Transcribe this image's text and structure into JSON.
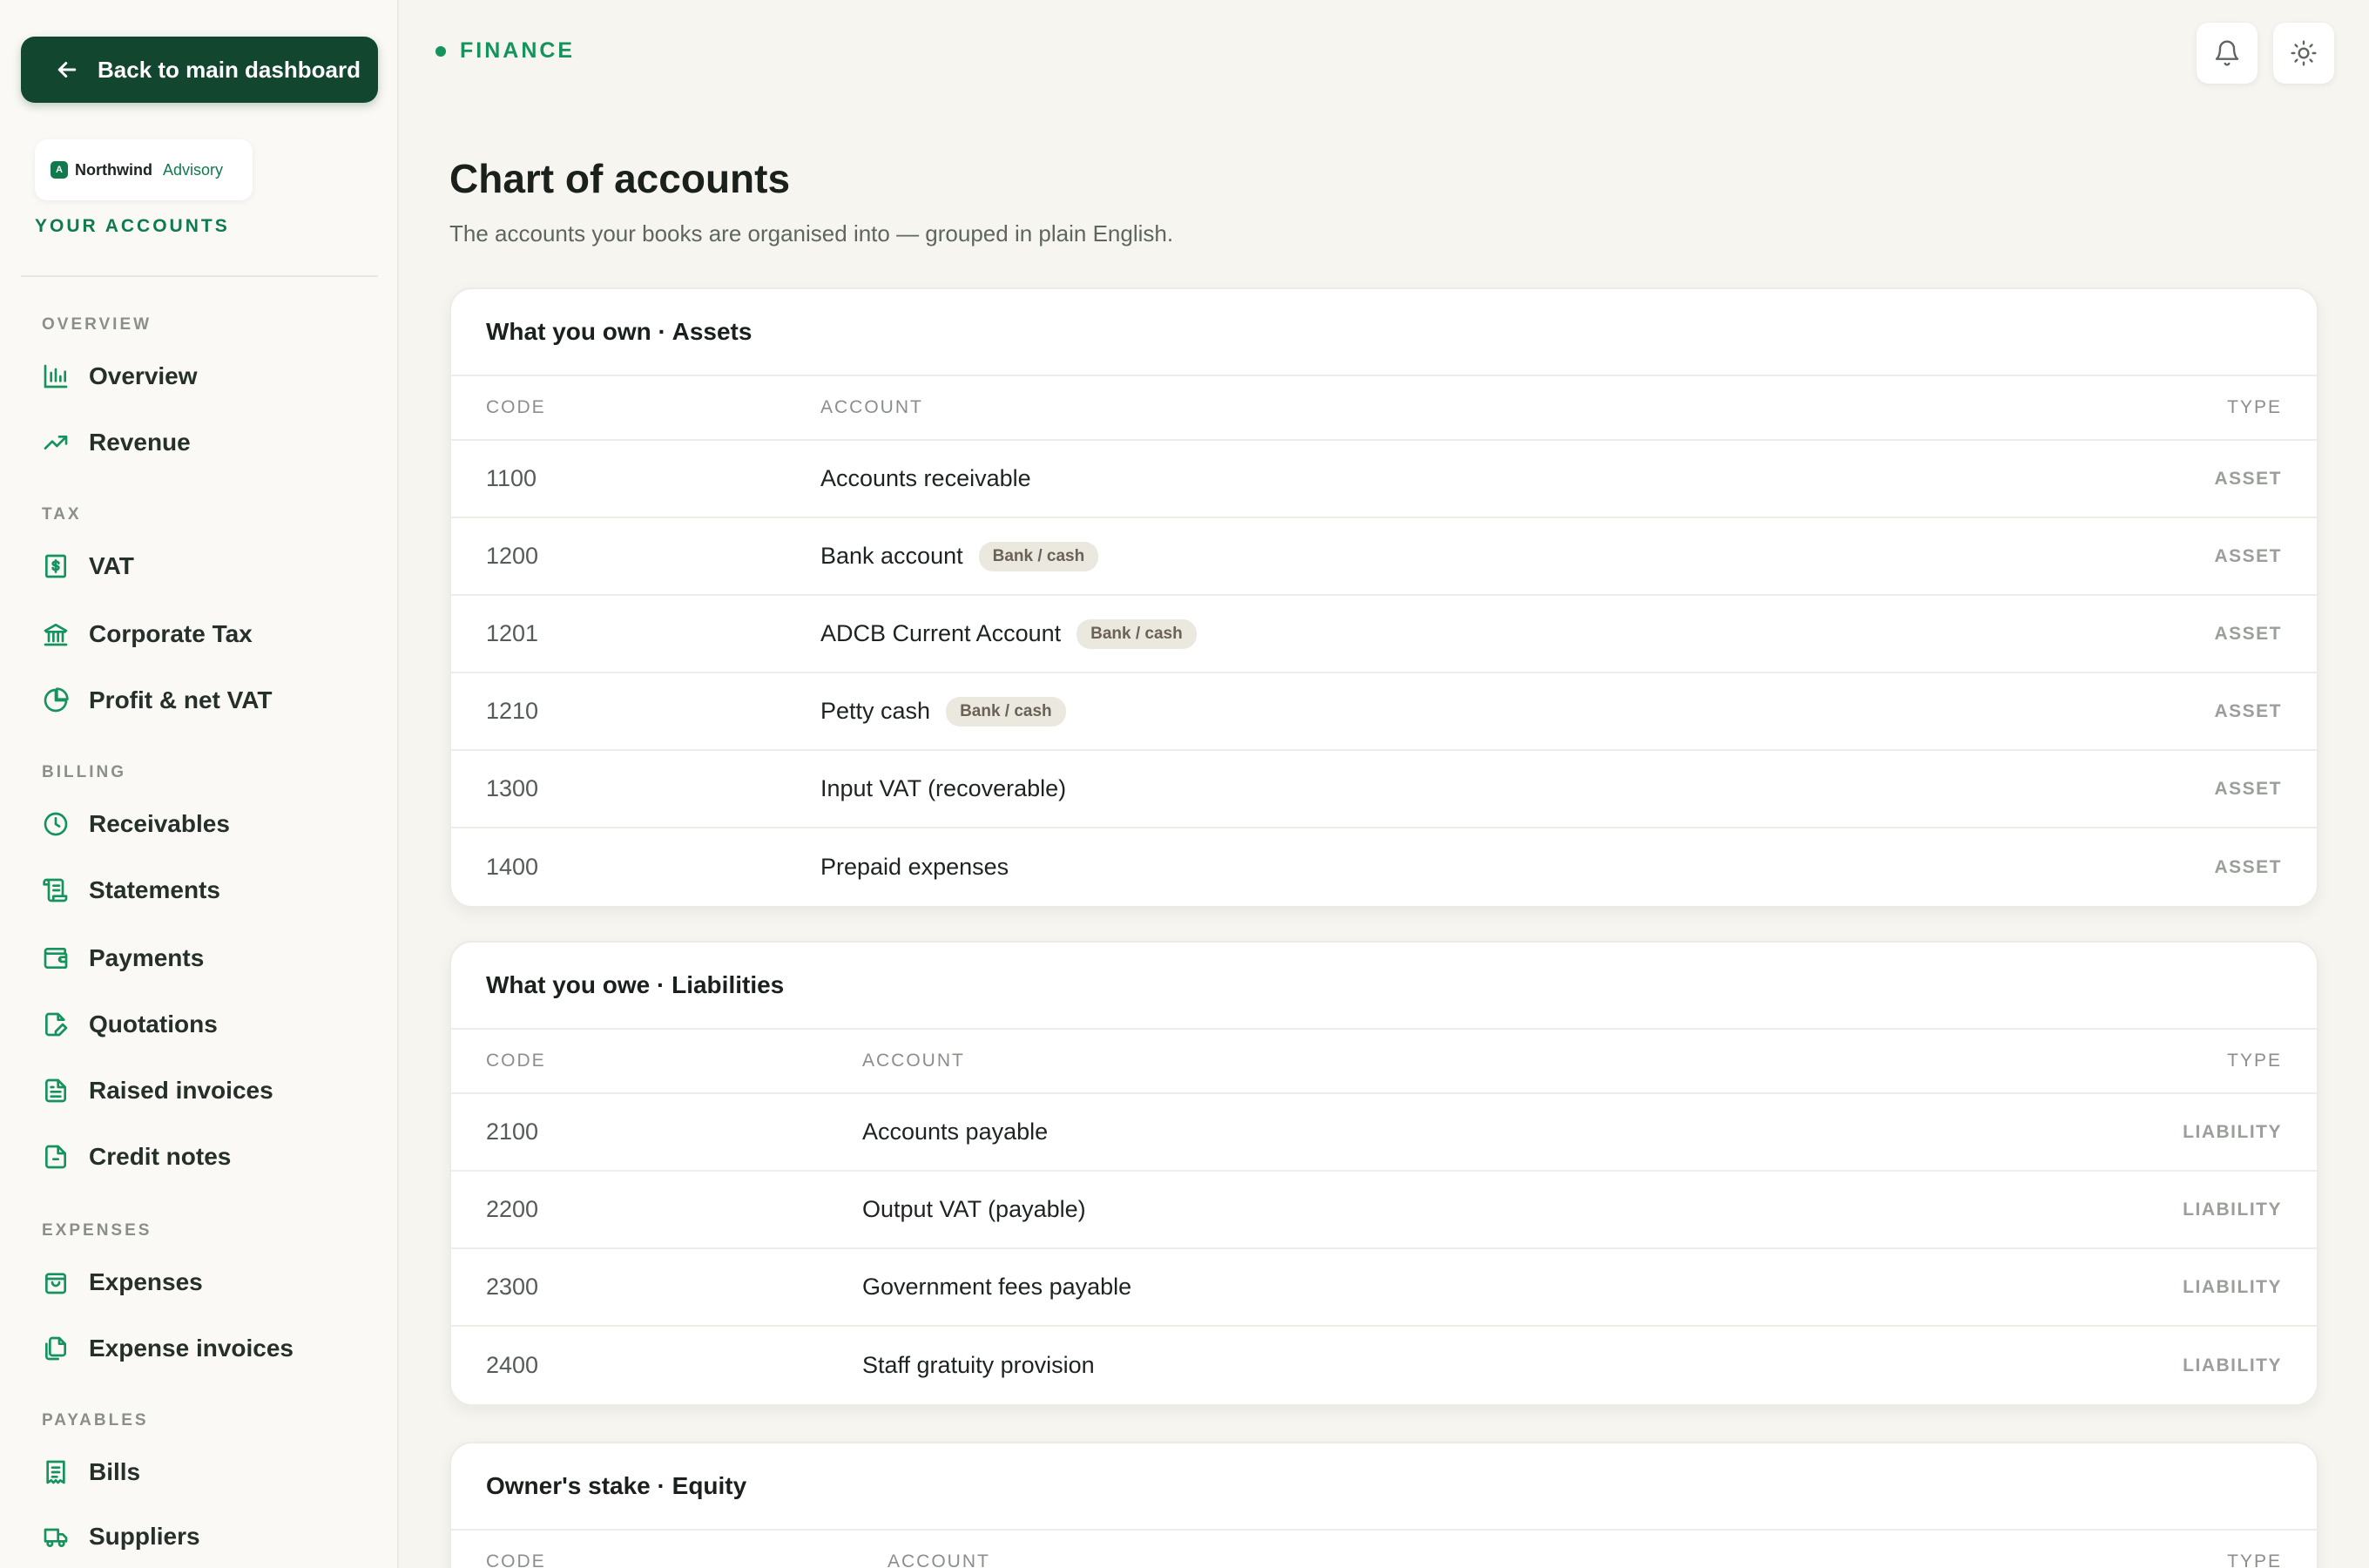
{
  "sidebar": {
    "back_label": "Back to main dashboard",
    "brand": {
      "name": "Northwind",
      "sub": "Advisory",
      "mark": "A"
    },
    "your_accounts": "YOUR ACCOUNTS",
    "sections": {
      "overview": "OVERVIEW",
      "tax": "TAX",
      "billing": "BILLING",
      "expenses": "EXPENSES",
      "payables": "PAYABLES"
    },
    "items": {
      "overview": "Overview",
      "revenue": "Revenue",
      "vat": "VAT",
      "corporate_tax": "Corporate Tax",
      "profit_vat": "Profit & net VAT",
      "receivables": "Receivables",
      "statements": "Statements",
      "payments": "Payments",
      "quotations": "Quotations",
      "raised_invoices": "Raised invoices",
      "credit_notes": "Credit notes",
      "expenses": "Expenses",
      "expense_invoices": "Expense invoices",
      "bills": "Bills",
      "suppliers": "Suppliers"
    }
  },
  "topbar": {
    "crumb": "FINANCE",
    "icons": [
      "bell-icon",
      "sun-icon"
    ]
  },
  "page": {
    "title": "Chart of accounts",
    "subtitle": "The accounts your books are organised into — grouped in plain English."
  },
  "columns": {
    "code": "CODE",
    "account": "ACCOUNT",
    "type": "TYPE"
  },
  "groups": {
    "assets": {
      "title": "What you own · Assets",
      "rows": [
        {
          "code": "1100",
          "account": "Accounts receivable",
          "tag": "",
          "type": "ASSET"
        },
        {
          "code": "1200",
          "account": "Bank account",
          "tag": "Bank / cash",
          "type": "ASSET"
        },
        {
          "code": "1201",
          "account": "ADCB Current Account",
          "tag": "Bank / cash",
          "type": "ASSET"
        },
        {
          "code": "1210",
          "account": "Petty cash",
          "tag": "Bank / cash",
          "type": "ASSET"
        },
        {
          "code": "1300",
          "account": "Input VAT (recoverable)",
          "tag": "",
          "type": "ASSET"
        },
        {
          "code": "1400",
          "account": "Prepaid expenses",
          "tag": "",
          "type": "ASSET"
        }
      ]
    },
    "liabilities": {
      "title": "What you owe · Liabilities",
      "rows": [
        {
          "code": "2100",
          "account": "Accounts payable",
          "type": "LIABILITY"
        },
        {
          "code": "2200",
          "account": "Output VAT (payable)",
          "type": "LIABILITY"
        },
        {
          "code": "2300",
          "account": "Government fees payable",
          "type": "LIABILITY"
        },
        {
          "code": "2400",
          "account": "Staff gratuity provision",
          "type": "LIABILITY"
        }
      ]
    },
    "equity": {
      "title": "Owner's stake · Equity"
    }
  },
  "colors": {
    "accent": "#14935c",
    "dark_green": "#13462f",
    "pill_bg": "#ebe8df"
  }
}
